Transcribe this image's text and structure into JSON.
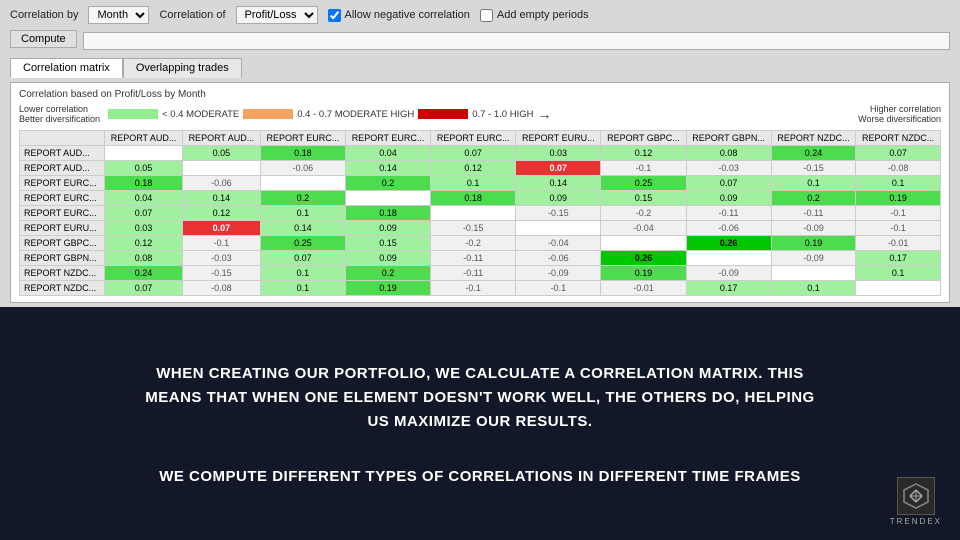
{
  "toolbar": {
    "correlation_by_label": "Correlation by",
    "correlation_by_value": "Month",
    "correlation_of_label": "Correlation of",
    "correlation_of_value": "Profit/Loss",
    "allow_negative_label": "Allow negative correlation",
    "add_empty_label": "Add empty periods",
    "compute_button": "Compute"
  },
  "tabs": {
    "tab1": "Correlation matrix",
    "tab2": "Overlapping trades"
  },
  "correlation_info": "Correlation based on Profit/Loss by Month",
  "legend": {
    "lower_left1": "Lower correlation",
    "lower_left2": "Better diversification",
    "mod_label": "< 0.4 MODERATE",
    "mod_high_label": "0.4 - 0.7 MODERATE HIGH",
    "high_label": "0.7 - 1.0 HIGH",
    "higher_right1": "Higher correlation",
    "higher_right2": "Worse diversification"
  },
  "matrix": {
    "col_headers": [
      "REPORT AUD...",
      "REPORT AUD...",
      "REPORT EURC...",
      "REPORT EURC...",
      "REPORT EURC...",
      "REPORT EURU...",
      "REPORT GBPC...",
      "REPORT GBPN...",
      "REPORT NZDC...",
      "REPORT NZDC..."
    ],
    "rows": [
      {
        "header": "REPORT AUD...",
        "cells": [
          "",
          "0.05",
          "0.18",
          "0.04",
          "0.07",
          "0.03",
          "0.12",
          "0.08",
          "0.24",
          "0.07"
        ],
        "styles": [
          "cell-empty",
          "cell-green-light",
          "cell-green-med",
          "cell-green-light",
          "cell-green-light",
          "cell-green-light",
          "cell-green-light",
          "cell-green-light",
          "cell-green-med",
          "cell-green-light"
        ]
      },
      {
        "header": "REPORT AUD...",
        "cells": [
          "0.05",
          "",
          "-0.06",
          "0.14",
          "0.12",
          "0.07",
          "-0.1",
          "-0.03",
          "-0.15",
          "-0.08"
        ],
        "styles": [
          "cell-green-light",
          "cell-empty",
          "cell-neg",
          "cell-green-light",
          "cell-green-light",
          "cell-red",
          "cell-neg",
          "cell-neg",
          "cell-neg",
          "cell-neg"
        ]
      },
      {
        "header": "REPORT EURC...",
        "cells": [
          "0.18",
          "-0.06",
          "",
          "0.2",
          "0.1",
          "0.14",
          "0.25",
          "0.07",
          "0.1",
          "0.1"
        ],
        "styles": [
          "cell-green-med",
          "cell-neg",
          "cell-empty",
          "cell-green-med",
          "cell-green-light",
          "cell-green-light",
          "cell-green-med",
          "cell-green-light",
          "cell-green-light",
          "cell-green-light"
        ]
      },
      {
        "header": "REPORT EURC...",
        "cells": [
          "0.04",
          "0.14",
          "0.2",
          "",
          "0.18",
          "0.09",
          "0.15",
          "0.09",
          "0.2",
          "0.19"
        ],
        "styles": [
          "cell-green-light",
          "cell-green-light",
          "cell-green-med",
          "cell-empty",
          "cell-green-med",
          "cell-green-light",
          "cell-green-light",
          "cell-green-light",
          "cell-green-med",
          "cell-green-med"
        ]
      },
      {
        "header": "REPORT EURC...",
        "cells": [
          "0.07",
          "0.12",
          "0.1",
          "0.18",
          "",
          "-0.15",
          "-0.2",
          "-0.11",
          "-0.11",
          "-0.1"
        ],
        "styles": [
          "cell-green-light",
          "cell-green-light",
          "cell-green-light",
          "cell-green-med",
          "cell-empty",
          "cell-neg",
          "cell-neg",
          "cell-neg",
          "cell-neg",
          "cell-neg"
        ]
      },
      {
        "header": "REPORT EURU...",
        "cells": [
          "0.03",
          "0.07",
          "0.14",
          "0.09",
          "-0.15",
          "",
          "-0.04",
          "-0.06",
          "-0.09",
          "-0.1"
        ],
        "styles": [
          "cell-green-light",
          "cell-red",
          "cell-green-light",
          "cell-green-light",
          "cell-neg",
          "cell-empty",
          "cell-neg",
          "cell-neg",
          "cell-neg",
          "cell-neg"
        ]
      },
      {
        "header": "REPORT GBPC...",
        "cells": [
          "0.12",
          "-0.1",
          "0.25",
          "0.15",
          "-0.2",
          "-0.04",
          "",
          "0.26",
          "0.19",
          "-0.01"
        ],
        "styles": [
          "cell-green-light",
          "cell-neg",
          "cell-green-med",
          "cell-green-light",
          "cell-neg",
          "cell-neg",
          "cell-empty",
          "cell-green-dark",
          "cell-green-med",
          "cell-neg"
        ]
      },
      {
        "header": "REPORT GBPN...",
        "cells": [
          "0.08",
          "-0.03",
          "0.07",
          "0.09",
          "-0.11",
          "-0.06",
          "0.26",
          "",
          "-0.09",
          "0.17"
        ],
        "styles": [
          "cell-green-light",
          "cell-neg",
          "cell-green-light",
          "cell-green-light",
          "cell-neg",
          "cell-neg",
          "cell-green-dark",
          "cell-empty",
          "cell-neg",
          "cell-green-light"
        ]
      },
      {
        "header": "REPORT NZDC...",
        "cells": [
          "0.24",
          "-0.15",
          "0.1",
          "0.2",
          "-0.11",
          "-0.09",
          "0.19",
          "-0.09",
          "",
          "0.1"
        ],
        "styles": [
          "cell-green-med",
          "cell-neg",
          "cell-green-light",
          "cell-green-med",
          "cell-neg",
          "cell-neg",
          "cell-green-med",
          "cell-neg",
          "cell-empty",
          "cell-green-light"
        ]
      },
      {
        "header": "REPORT NZDC...",
        "cells": [
          "0.07",
          "-0.08",
          "0.1",
          "0.19",
          "-0.1",
          "-0.1",
          "-0.01",
          "0.17",
          "0.1",
          ""
        ],
        "styles": [
          "cell-green-light",
          "cell-neg",
          "cell-green-light",
          "cell-green-med",
          "cell-neg",
          "cell-neg",
          "cell-neg",
          "cell-green-light",
          "cell-green-light",
          "cell-empty"
        ]
      }
    ]
  },
  "bottom": {
    "main_text": "WHEN CREATING OUR PORTFOLIO, WE CALCULATE A CORRELATION MATRIX. THIS\nMEANS THAT WHEN ONE ELEMENT DOESN'T WORK WELL, THE OTHERS DO, HELPING\nUS MAXIMIZE OUR RESULTS.",
    "sub_text": "WE COMPUTE DIFFERENT TYPES OF CORRELATIONS IN DIFFERENT TIME FRAMES"
  },
  "logo": {
    "text": "TRENDEX"
  }
}
